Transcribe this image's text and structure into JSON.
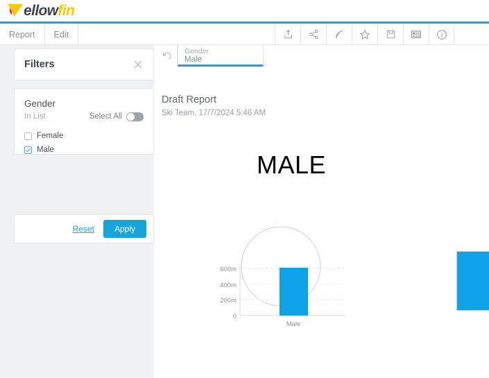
{
  "header": {
    "logo_text_part1": "ellow",
    "logo_text_part2": "fin",
    "logo_icon": "yellowfin-chevron-logo",
    "accent_color": "#17a3dc",
    "brand_yellow": "#fdc800"
  },
  "toolbar": {
    "menu": [
      {
        "label": "Report",
        "name": "menu-report"
      },
      {
        "label": "Edit",
        "name": "menu-edit"
      }
    ],
    "icons": [
      {
        "name": "export-icon",
        "title": "Export"
      },
      {
        "name": "share-icon",
        "title": "Share"
      },
      {
        "name": "broadcast-icon",
        "title": "Broadcast"
      },
      {
        "name": "favorite-star-icon",
        "title": "Favourite"
      },
      {
        "name": "save-icon",
        "title": "Save"
      },
      {
        "name": "story-book-icon",
        "title": "Story"
      },
      {
        "name": "info-icon",
        "title": "Info"
      }
    ]
  },
  "sidebar": {
    "panel_title": "Filters",
    "close_icon": "close-icon",
    "filter": {
      "name": "Gender",
      "operator": "In List",
      "select_all_label": "Select All",
      "select_all_on": false,
      "options": [
        {
          "label": "Female",
          "checked": false
        },
        {
          "label": "Male",
          "checked": true
        }
      ]
    },
    "reset_label": "Reset",
    "apply_label": "Apply"
  },
  "main": {
    "undo_icon": "undo-icon",
    "tab": {
      "field": "Gender",
      "value": "Male"
    },
    "report_title": "Draft Report",
    "report_subtitle": "Ski Team, 17/7/2024 5:46 AM",
    "big_label": "MALE"
  },
  "chart_data": {
    "type": "bar",
    "title": "",
    "categories": [
      "Male"
    ],
    "values": [
      600
    ],
    "value_labels": [
      "600m"
    ],
    "xlabel": "",
    "ylabel": "",
    "ylim": [
      0,
      700
    ],
    "yticks": [
      0,
      200,
      400,
      600
    ],
    "ytick_labels": [
      "0",
      "200m",
      "400m",
      "600m"
    ],
    "grid": true,
    "legend": "none",
    "bar_color": "#0ea2e8",
    "series": [
      {
        "name": "Male",
        "values": [
          600
        ]
      }
    ],
    "overlay_shape": {
      "type": "circle-outline",
      "color": "#cfd3d8"
    }
  }
}
